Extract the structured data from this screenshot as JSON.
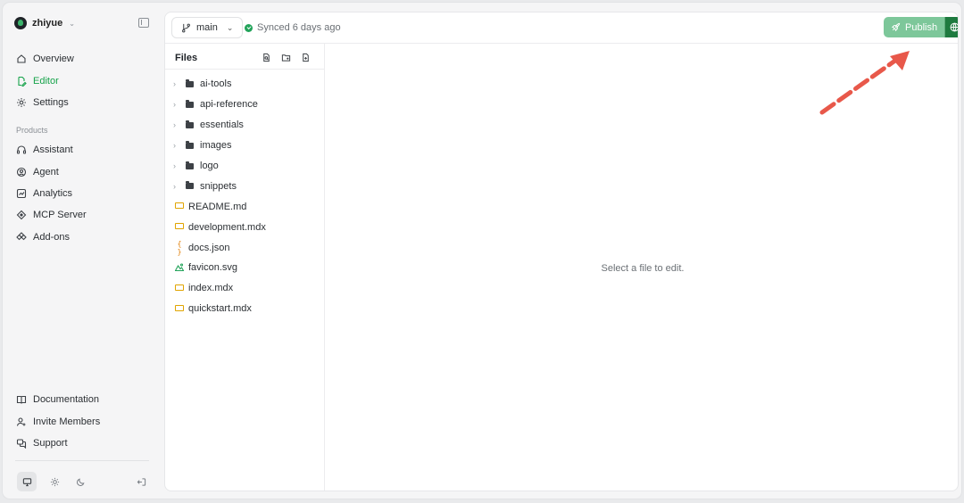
{
  "org": {
    "name": "zhiyue"
  },
  "nav_main": [
    {
      "label": "Overview",
      "icon": "home-icon"
    },
    {
      "label": "Editor",
      "icon": "edit-file-icon",
      "active": true
    },
    {
      "label": "Settings",
      "icon": "gear-icon"
    }
  ],
  "products_label": "Products",
  "nav_products": [
    {
      "label": "Assistant",
      "icon": "headset-icon"
    },
    {
      "label": "Agent",
      "icon": "agent-icon"
    },
    {
      "label": "Analytics",
      "icon": "analytics-icon"
    },
    {
      "label": "MCP Server",
      "icon": "mcp-icon"
    },
    {
      "label": "Add-ons",
      "icon": "addons-icon"
    }
  ],
  "nav_bottom": [
    {
      "label": "Documentation",
      "icon": "book-icon"
    },
    {
      "label": "Invite Members",
      "icon": "invite-icon"
    },
    {
      "label": "Support",
      "icon": "support-icon"
    }
  ],
  "topbar": {
    "branch": "main",
    "sync_status": "Synced 6 days ago",
    "publish_label": "Publish"
  },
  "files": {
    "title": "Files",
    "folders": [
      "ai-tools",
      "api-reference",
      "essentials",
      "images",
      "logo",
      "snippets"
    ],
    "items": [
      {
        "name": "README.md",
        "type": "md"
      },
      {
        "name": "development.mdx",
        "type": "md"
      },
      {
        "name": "docs.json",
        "type": "json"
      },
      {
        "name": "favicon.svg",
        "type": "svg"
      },
      {
        "name": "index.mdx",
        "type": "md"
      },
      {
        "name": "quickstart.mdx",
        "type": "md"
      }
    ]
  },
  "editor": {
    "empty_message": "Select a file to edit."
  },
  "colors": {
    "accent": "#16a34a",
    "publish": "#7dc79a",
    "publish_dark": "#1e7a3f",
    "annotation_arrow": "#e8584a"
  }
}
